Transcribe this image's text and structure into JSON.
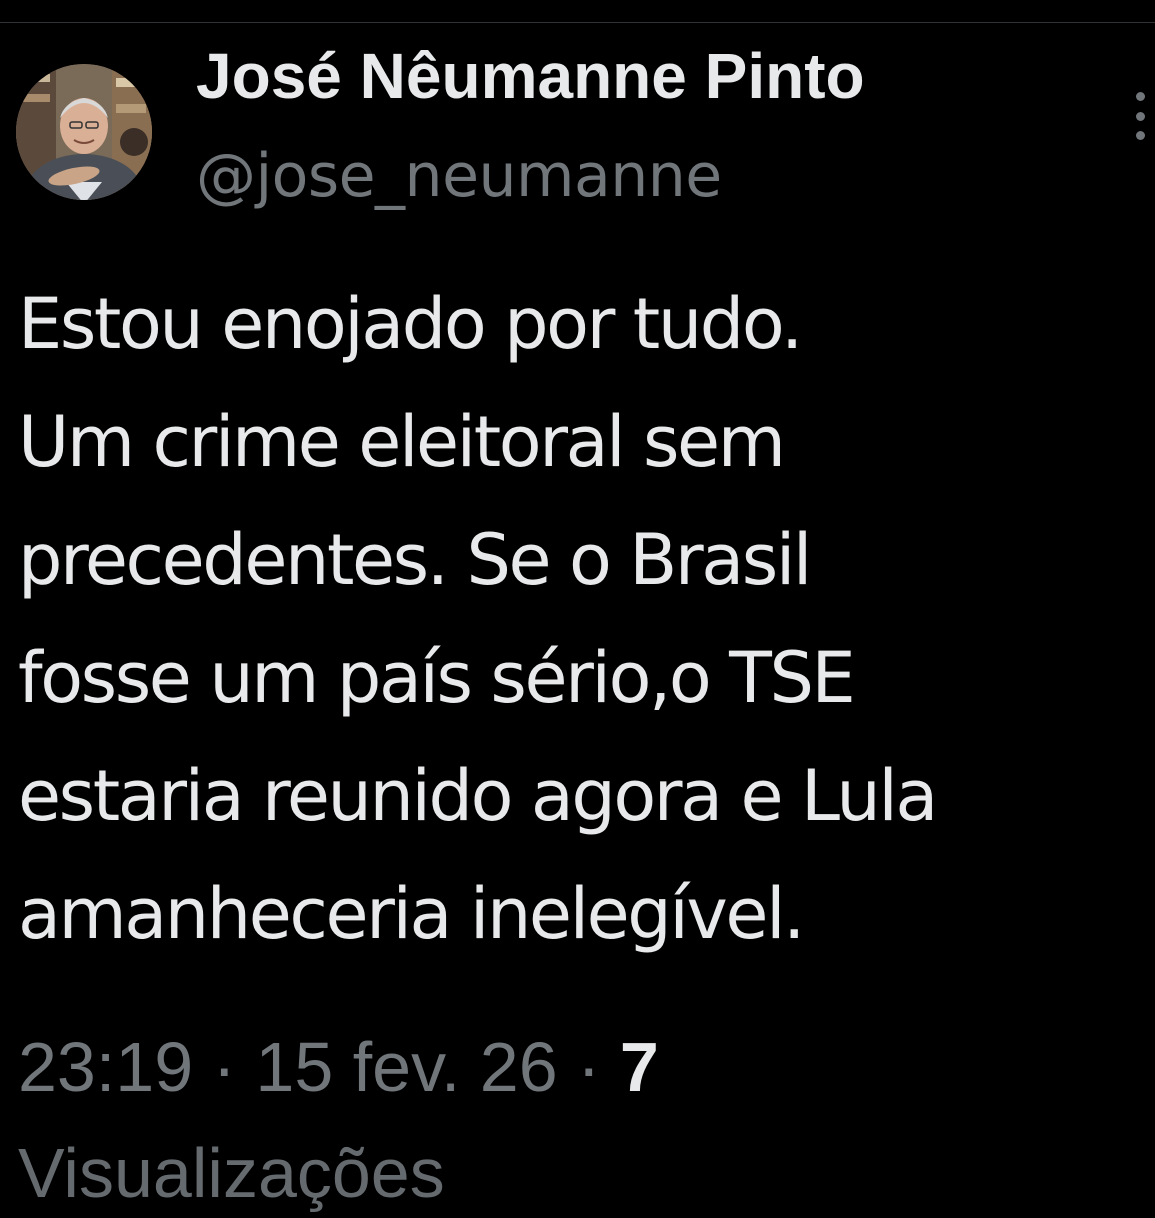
{
  "author": {
    "display_name": "José Nêumanne Pinto",
    "handle": "@jose_neumanne",
    "avatar_icon": "profile-photo"
  },
  "more_menu_icon": "vertical-ellipsis-icon",
  "tweet": {
    "lines": [
      "Estou enojado por tudo.",
      "Um crime eleitoral sem",
      "precedentes. Se o Brasil",
      "fosse um país sério,o TSE",
      "estaria reunido agora e Lula",
      "amanheceria inelegível."
    ]
  },
  "meta": {
    "time": "23:19",
    "separator": "·",
    "date": "15 fev. 26",
    "views": "7",
    "cut_off_label": "Visualizações"
  },
  "colors": {
    "background": "#000000",
    "primary_text": "#e7e9ea",
    "secondary_text": "#71767b"
  }
}
